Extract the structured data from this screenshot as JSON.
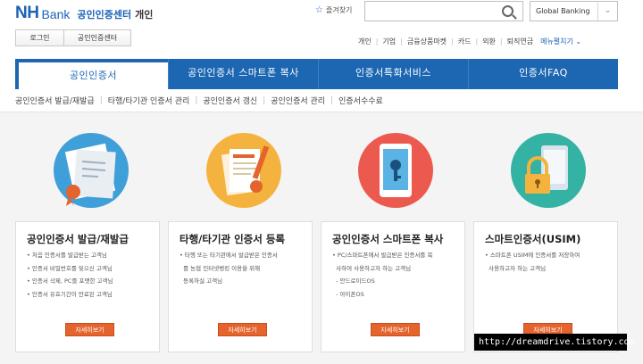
{
  "header": {
    "logo_nh": "NH",
    "logo_bank": "Bank",
    "logo_center": "공인인증센터",
    "logo_personal": "개인",
    "favorites_label": "즐겨찾기",
    "search_placeholder": "",
    "global_select_value": "Global Banking"
  },
  "login_buttons": [
    "로그인",
    "공인인증센터"
  ],
  "top_menu": {
    "items": [
      "개인",
      "기업",
      "금융상품마켓",
      "카드",
      "외환",
      "퇴직연금"
    ],
    "more_label": "메뉴펼치기 ⌄"
  },
  "main_nav": {
    "tabs": [
      "공인인증서",
      "공인인증서 스마트폰 복사",
      "인증서특화서비스",
      "인증서FAQ"
    ]
  },
  "sub_nav": {
    "items": [
      "공인인증서 발급/재발급",
      "타행/타기관 인증서 관리",
      "공인인증서 갱신",
      "공인인증서 관리",
      "인증서수수료"
    ]
  },
  "cards": [
    {
      "title": "공인인증서 발급/재발급",
      "items": [
        "처음 인증서를 발급받는 고객님",
        "인증서 비밀번호를 잊으신 고객님",
        "인증서 삭제, PC를 포맷한 고객님",
        "인증서 유효기간이 만료된 고객님"
      ],
      "button": "자세히보기"
    },
    {
      "title": "타행/타기관 인증서 등록",
      "items": [
        "타행 또는 타기관에서 발급받은 인증서",
        "를 농협 인터넷뱅킹 이용을 위해",
        "등록하실 고객님"
      ],
      "button": "자세히보기"
    },
    {
      "title": "공인인증서 스마트폰 복사",
      "items": [
        "PC/스마트폰에서 발급받은 인증서를 복",
        "사하여 사용하고자 하는 고객님",
        "- 안드로이드OS",
        "- 아이폰OS"
      ],
      "button": "자세히보기"
    },
    {
      "title": "스마트인증서(USIM)",
      "items": [
        "스마트폰 USIM에 인증서를 저장하여",
        "사용하고자 하는 고객님"
      ],
      "button": "자세히보기"
    }
  ],
  "watermark": "http://dreamdrive.tistory.com",
  "colors": {
    "brand_blue": "#1c66b2",
    "button_orange": "#e5632c",
    "illust_blue": "#3f9fd9",
    "illust_yellow": "#f4b33f",
    "illust_red": "#ec5a4f",
    "illust_teal": "#34b2a4"
  }
}
